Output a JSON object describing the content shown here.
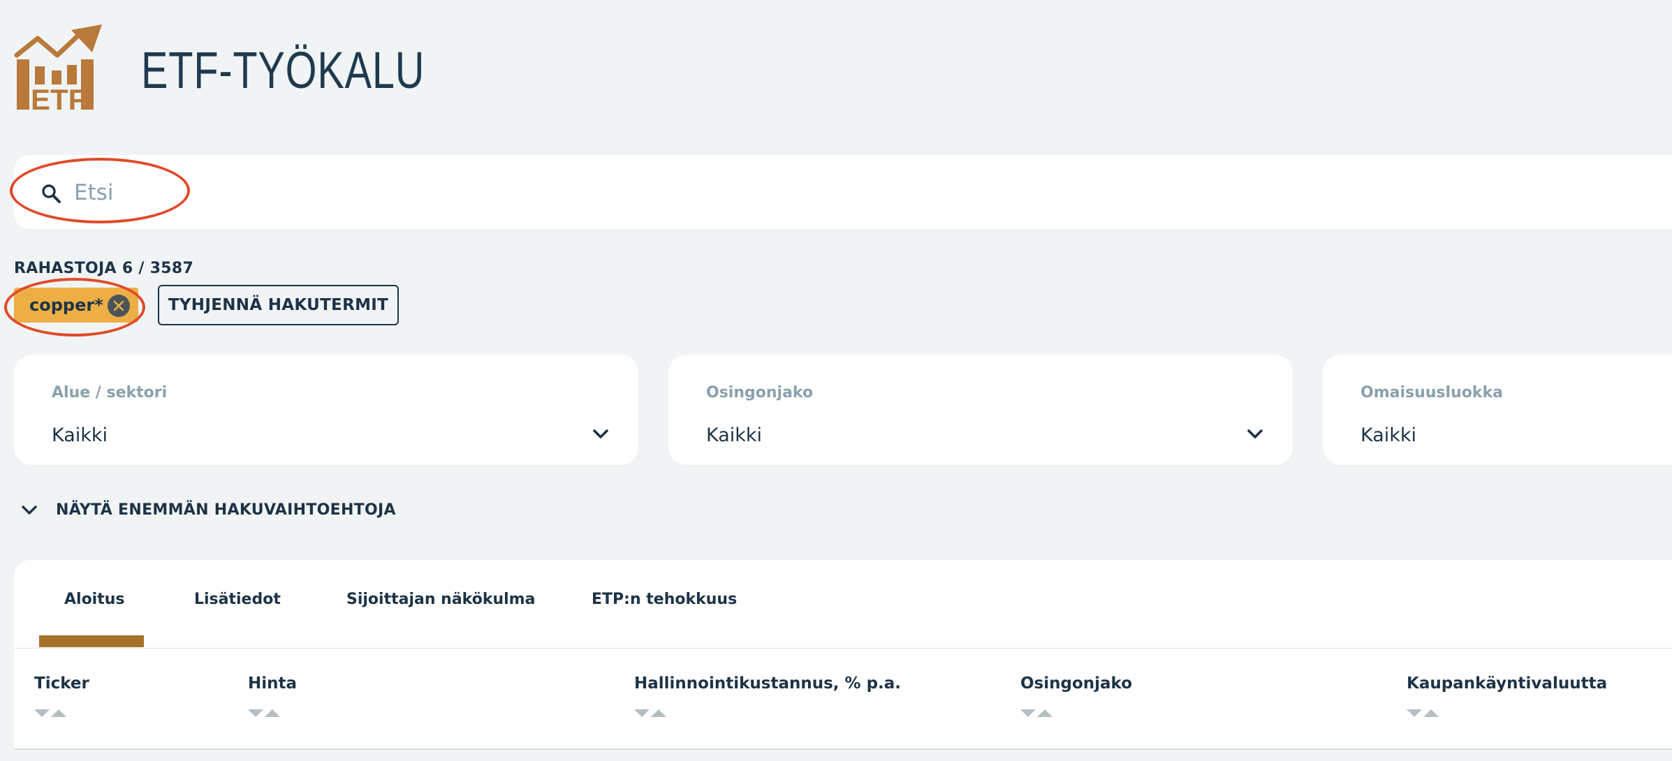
{
  "app": {
    "title": "ETF-TYÖKALU",
    "logo_icon": "etf-growth-chart-logo-icon",
    "logo_text": "ETF"
  },
  "search": {
    "placeholder": "Etsi",
    "value": "",
    "icon": "search-icon"
  },
  "results": {
    "count_label": "RAHASTOJA 6 / 3587"
  },
  "active_filters": [
    {
      "label": "copper*",
      "icon": "close-circle-icon"
    }
  ],
  "clear_button_label": "TYHJENNÄ HAKUTERMIT",
  "filters": [
    {
      "label": "Alue / sektori",
      "value": "Kaikki"
    },
    {
      "label": "Osingonjako",
      "value": "Kaikki"
    },
    {
      "label": "Omaisuusluokka",
      "value": "Kaikki"
    }
  ],
  "more_options_label": "NÄYTÄ ENEMMÄN HAKUVAIHTOEHTOJA",
  "tabs": [
    {
      "label": "Aloitus",
      "active": true
    },
    {
      "label": "Lisätiedot",
      "active": false
    },
    {
      "label": "Sijoittajan näkökulma",
      "active": false
    },
    {
      "label": "ETP:n tehokkuus",
      "active": false
    }
  ],
  "table": {
    "columns": [
      "Ticker",
      "Hinta",
      "Hallinnointikustannus, % p.a.",
      "Osingonjako",
      "Kaupankäyntivaluutta"
    ]
  },
  "colors": {
    "background": "#f0f4f5",
    "accent": "#a57329",
    "chip": "#ecae45",
    "text": "#1d3346",
    "muted": "#8aa0ae",
    "annotation": "#e04a2a"
  }
}
